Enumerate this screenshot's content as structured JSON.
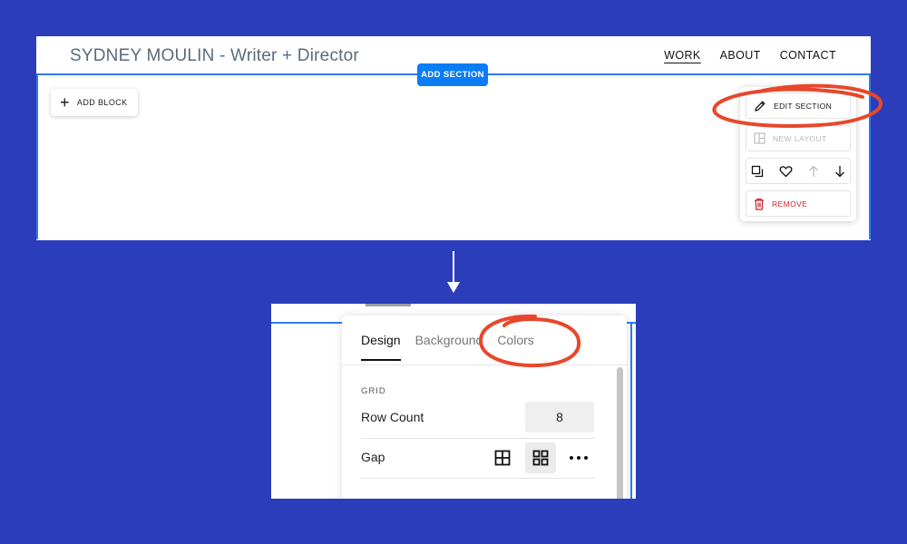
{
  "top_screenshot": {
    "site_title": "SYDNEY MOULIN - Writer + Director",
    "nav": [
      {
        "label": "WORK",
        "active": true
      },
      {
        "label": "ABOUT",
        "active": false
      },
      {
        "label": "CONTACT",
        "active": false
      }
    ],
    "add_section_label": "ADD SECTION",
    "add_block_label": "ADD BLOCK",
    "section_menu": {
      "edit_section_label": "EDIT SECTION",
      "new_layout_label": "NEW LAYOUT",
      "remove_label": "REMOVE",
      "icons": [
        "duplicate-icon",
        "heart-icon",
        "arrow-up-icon",
        "arrow-down-icon"
      ]
    }
  },
  "bottom_screenshot": {
    "tabs": [
      {
        "label": "Design",
        "active": true
      },
      {
        "label": "Background",
        "active": false
      },
      {
        "label": "Colors",
        "active": false
      }
    ],
    "grid_heading": "GRID",
    "row_count_label": "Row Count",
    "row_count_value": "8",
    "gap_label": "Gap",
    "gap_options": [
      "grid-large-gap-icon",
      "grid-small-gap-icon",
      "more-options-icon"
    ],
    "gap_selected": "grid-small-gap-icon"
  },
  "colors": {
    "background": "#2b3dbb",
    "accent_blue": "#0a7cf5",
    "highlight_red": "#e8472b",
    "remove_red": "#c8202c"
  }
}
